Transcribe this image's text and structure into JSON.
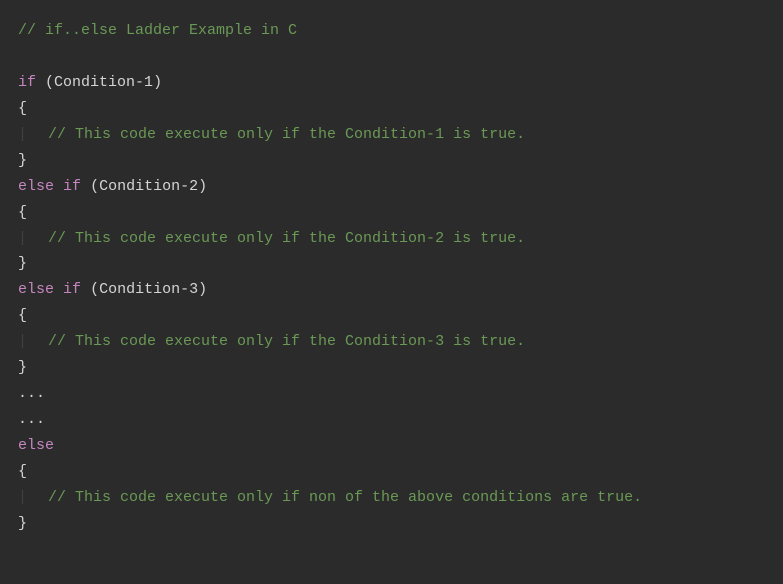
{
  "lines": {
    "l1_comment": "// if..else Ladder Example in C",
    "l3_if": "if",
    "l3_space": " ",
    "l3_open_paren": "(",
    "l3_cond": "Condition-1",
    "l3_close_paren": ")",
    "l4_brace": "{",
    "l5_comment": "// This code execute only if the Condition-1 is true.",
    "l6_brace": "}",
    "l7_else": "else",
    "l7_if": "if",
    "l7_open_paren": "(",
    "l7_cond": "Condition-2",
    "l7_close_paren": ")",
    "l8_brace": "{",
    "l9_comment": "// This code execute only if the Condition-2 is true.",
    "l10_brace": "}",
    "l11_else": "else",
    "l11_if": "if",
    "l11_open_paren": "(",
    "l11_cond": "Condition-3",
    "l11_close_paren": ")",
    "l12_brace": "{",
    "l13_comment": "// This code execute only if the Condition-3 is true.",
    "l14_brace": "}",
    "l15_dots": "...",
    "l16_dots": "...",
    "l17_else": "else",
    "l18_brace": "{",
    "l19_comment": "// This code execute only if non of the above conditions are true.",
    "l20_brace": "}",
    "indent_guide": "|",
    "space": " "
  }
}
